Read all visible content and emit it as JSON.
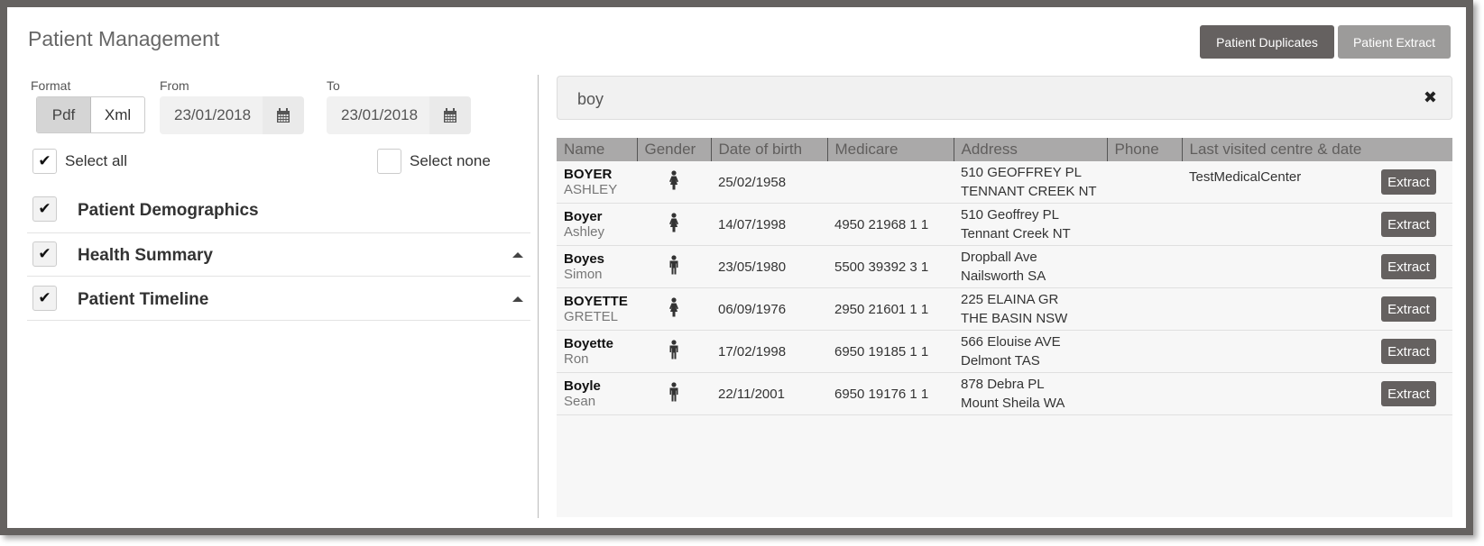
{
  "header": {
    "title": "Patient Management",
    "buttons": {
      "duplicates": "Patient Duplicates",
      "extract": "Patient Extract"
    }
  },
  "filters": {
    "format_label": "Format",
    "format_options": [
      "Pdf",
      "Xml"
    ],
    "format_selected": "Pdf",
    "from_label": "From",
    "from_value": "23/01/2018",
    "to_label": "To",
    "to_value": "23/01/2018",
    "select_all_label": "Select all",
    "select_all_checked": true,
    "select_none_label": "Select none",
    "select_none_checked": false
  },
  "sections": [
    {
      "label": "Patient Demographics",
      "checked": true,
      "collapsible": false
    },
    {
      "label": "Health Summary",
      "checked": true,
      "collapsible": true
    },
    {
      "label": "Patient Timeline",
      "checked": true,
      "collapsible": true
    }
  ],
  "search": {
    "value": "boy",
    "clear_icon": "close-icon"
  },
  "table": {
    "columns": [
      "Name",
      "Gender",
      "Date of birth",
      "Medicare",
      "Address",
      "Phone",
      "Last visited centre & date"
    ],
    "extract_label": "Extract",
    "rows": [
      {
        "surname": "BOYER",
        "given": "ASHLEY",
        "gender": "female",
        "dob": "25/02/1958",
        "medicare": "",
        "address1": "510 GEOFFREY PL",
        "address2": "TENNANT CREEK NT",
        "phone": "",
        "last_visited": "TestMedicalCenter"
      },
      {
        "surname": "Boyer",
        "given": "Ashley",
        "gender": "female",
        "dob": "14/07/1998",
        "medicare": "4950 21968 1  1",
        "address1": "510 Geoffrey PL",
        "address2": "Tennant Creek NT",
        "phone": "",
        "last_visited": ""
      },
      {
        "surname": "Boyes",
        "given": "Simon",
        "gender": "male",
        "dob": "23/05/1980",
        "medicare": "5500 39392 3  1",
        "address1": "Dropball Ave",
        "address2": "Nailsworth SA",
        "phone": "",
        "last_visited": ""
      },
      {
        "surname": "BOYETTE",
        "given": "GRETEL",
        "gender": "female",
        "dob": "06/09/1976",
        "medicare": "2950 21601 1  1",
        "address1": "225 ELAINA GR",
        "address2": "THE BASIN NSW",
        "phone": "",
        "last_visited": ""
      },
      {
        "surname": "Boyette",
        "given": "Ron",
        "gender": "male",
        "dob": "17/02/1998",
        "medicare": "6950 19185 1  1",
        "address1": "566 Elouise AVE",
        "address2": "Delmont TAS",
        "phone": "",
        "last_visited": ""
      },
      {
        "surname": "Boyle",
        "given": "Sean",
        "gender": "male",
        "dob": "22/11/2001",
        "medicare": "6950 19176 1  1",
        "address1": "878 Debra PL",
        "address2": "Mount Sheila WA",
        "phone": "",
        "last_visited": ""
      }
    ]
  }
}
